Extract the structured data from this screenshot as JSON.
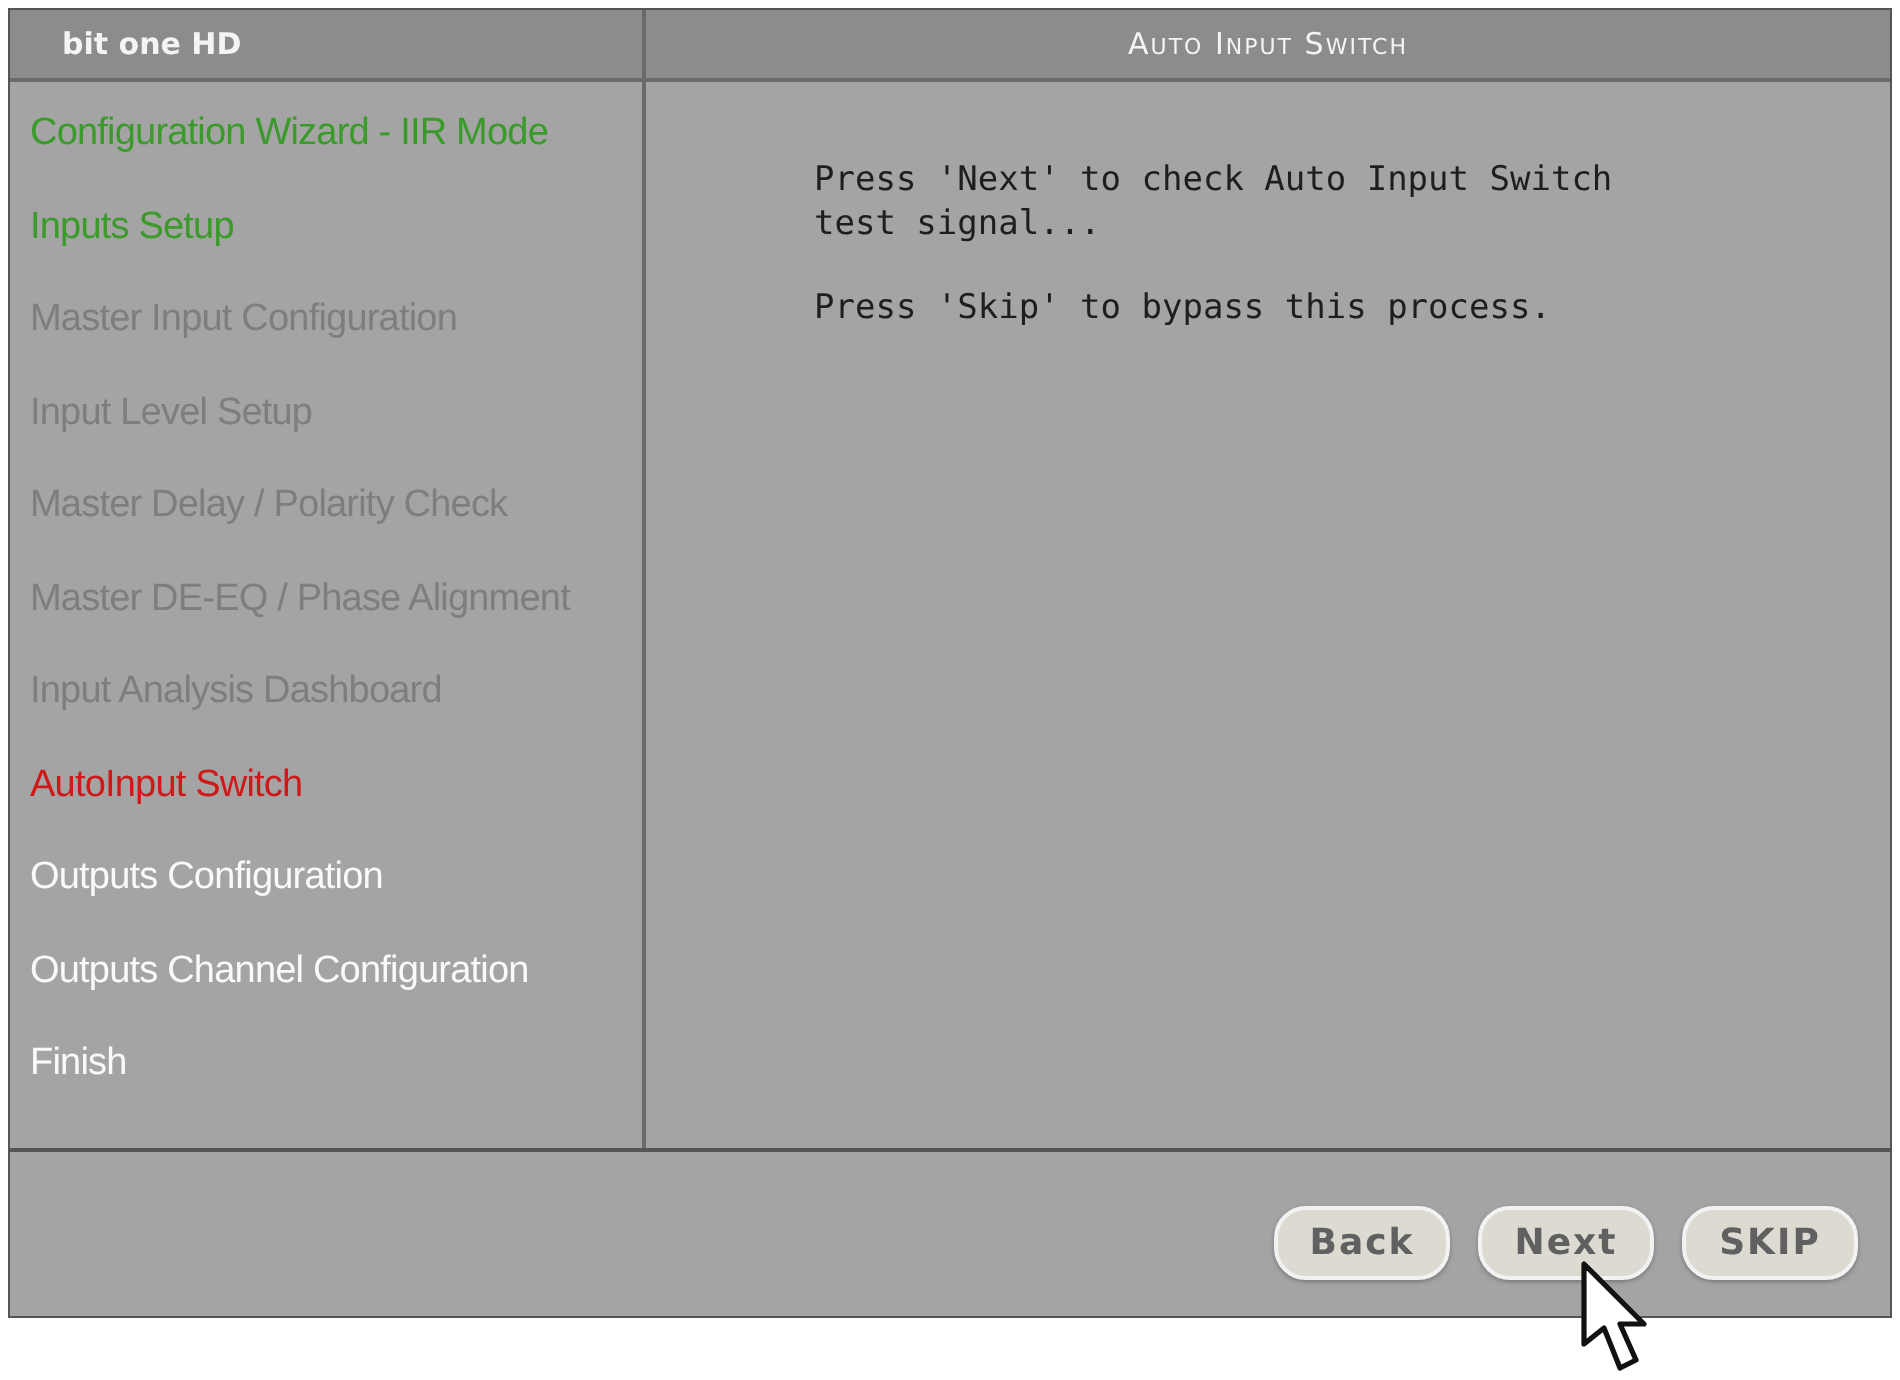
{
  "header": {
    "brand": "bit one HD",
    "title": "Auto Input Switch"
  },
  "steps": [
    {
      "label": "Configuration Wizard - IIR Mode",
      "kind": "done"
    },
    {
      "label": "Inputs Setup",
      "kind": "done"
    },
    {
      "label": "Master Input Configuration",
      "kind": "skipped"
    },
    {
      "label": "Input Level Setup",
      "kind": "skipped"
    },
    {
      "label": "Master Delay / Polarity Check",
      "kind": "skipped"
    },
    {
      "label": "Master DE-EQ / Phase Alignment",
      "kind": "skipped"
    },
    {
      "label": "Input Analysis Dashboard",
      "kind": "skipped"
    },
    {
      "label": "AutoInput Switch",
      "kind": "current"
    },
    {
      "label": "Outputs Configuration",
      "kind": "pending"
    },
    {
      "label": "Outputs Channel Configuration",
      "kind": "pending"
    },
    {
      "label": "Finish",
      "kind": "pending"
    }
  ],
  "messages": [
    "Press 'Next' to check Auto Input Switch test signal...",
    "Press 'Skip' to bypass this process."
  ],
  "buttons": [
    "Back",
    "Next",
    "SKIP"
  ]
}
